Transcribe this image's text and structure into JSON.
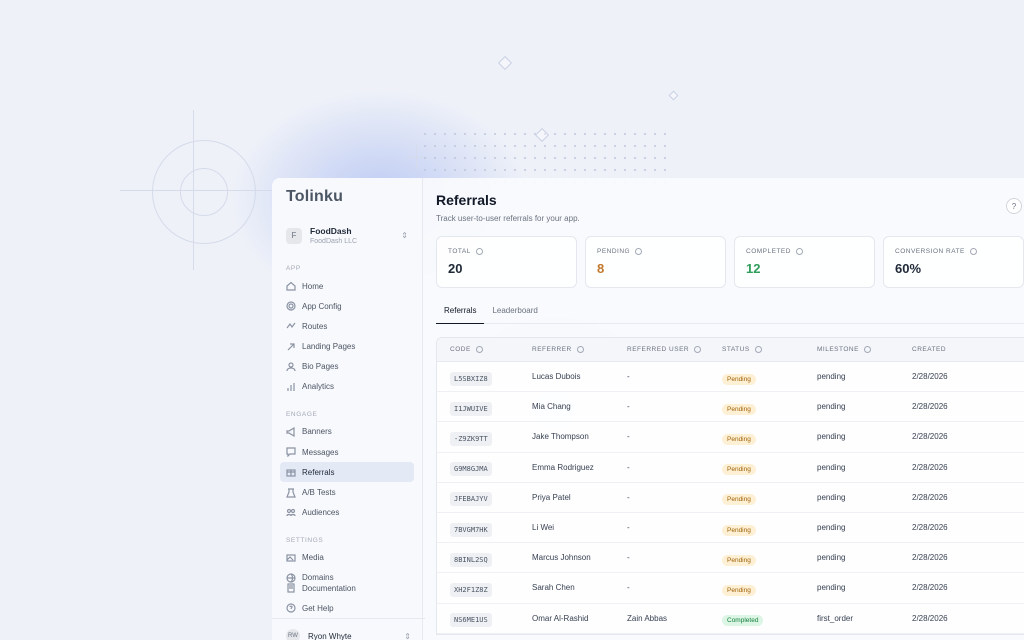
{
  "app": {
    "logo": "Tolinku"
  },
  "org": {
    "initial": "F",
    "name": "FoodDash",
    "sub": "FoodDash LLC"
  },
  "sidebar": {
    "sections": {
      "app": "APP",
      "engage": "ENGAGE",
      "settings": "SETTINGS"
    },
    "app_items": [
      "Home",
      "App Config",
      "Routes",
      "Landing Pages",
      "Bio Pages",
      "Analytics"
    ],
    "engage_items": [
      "Banners",
      "Messages",
      "Referrals",
      "A/B Tests",
      "Audiences"
    ],
    "settings_items": [
      "Media",
      "Domains"
    ],
    "footer_items": [
      "Documentation",
      "Get Help"
    ],
    "active": "Referrals"
  },
  "user": {
    "initials": "RW",
    "name": "Ryon Whyte"
  },
  "page": {
    "title": "Referrals",
    "subtitle": "Track user-to-user referrals for your app.",
    "help": "?"
  },
  "stats": [
    {
      "label": "TOTAL",
      "value": "20",
      "color": "#1f2937"
    },
    {
      "label": "PENDING",
      "value": "8",
      "color": "#c2782d"
    },
    {
      "label": "COMPLETED",
      "value": "12",
      "color": "#2f9e5b"
    },
    {
      "label": "CONVERSION RATE",
      "value": "60%",
      "color": "#1f2937"
    }
  ],
  "tabs": [
    "Referrals",
    "Leaderboard"
  ],
  "table": {
    "headers": [
      "CODE",
      "REFERRER",
      "REFERRED USER",
      "STATUS",
      "MILESTONE",
      "CREATED"
    ],
    "rows": [
      {
        "code": "L5SBXIZ8",
        "referrer": "Lucas Dubois",
        "referred": "-",
        "status": "Pending",
        "milestone": "pending",
        "created": "2/28/2026"
      },
      {
        "code": "I1JWUIVE",
        "referrer": "Mia Chang",
        "referred": "-",
        "status": "Pending",
        "milestone": "pending",
        "created": "2/28/2026"
      },
      {
        "code": "-Z9ZK9TT",
        "referrer": "Jake Thompson",
        "referred": "-",
        "status": "Pending",
        "milestone": "pending",
        "created": "2/28/2026"
      },
      {
        "code": "G9M8GJMA",
        "referrer": "Emma Rodriguez",
        "referred": "-",
        "status": "Pending",
        "milestone": "pending",
        "created": "2/28/2026"
      },
      {
        "code": "JFEBAJYV",
        "referrer": "Priya Patel",
        "referred": "-",
        "status": "Pending",
        "milestone": "pending",
        "created": "2/28/2026"
      },
      {
        "code": "7BVGM7HK",
        "referrer": "Li Wei",
        "referred": "-",
        "status": "Pending",
        "milestone": "pending",
        "created": "2/28/2026"
      },
      {
        "code": "8BINL2SQ",
        "referrer": "Marcus Johnson",
        "referred": "-",
        "status": "Pending",
        "milestone": "pending",
        "created": "2/28/2026"
      },
      {
        "code": "XH2F1Z8Z",
        "referrer": "Sarah Chen",
        "referred": "-",
        "status": "Pending",
        "milestone": "pending",
        "created": "2/28/2026"
      },
      {
        "code": "NS6ME1US",
        "referrer": "Omar Al-Rashid",
        "referred": "Zain Abbas",
        "status": "Completed",
        "milestone": "first_order",
        "created": "2/28/2026"
      }
    ]
  }
}
